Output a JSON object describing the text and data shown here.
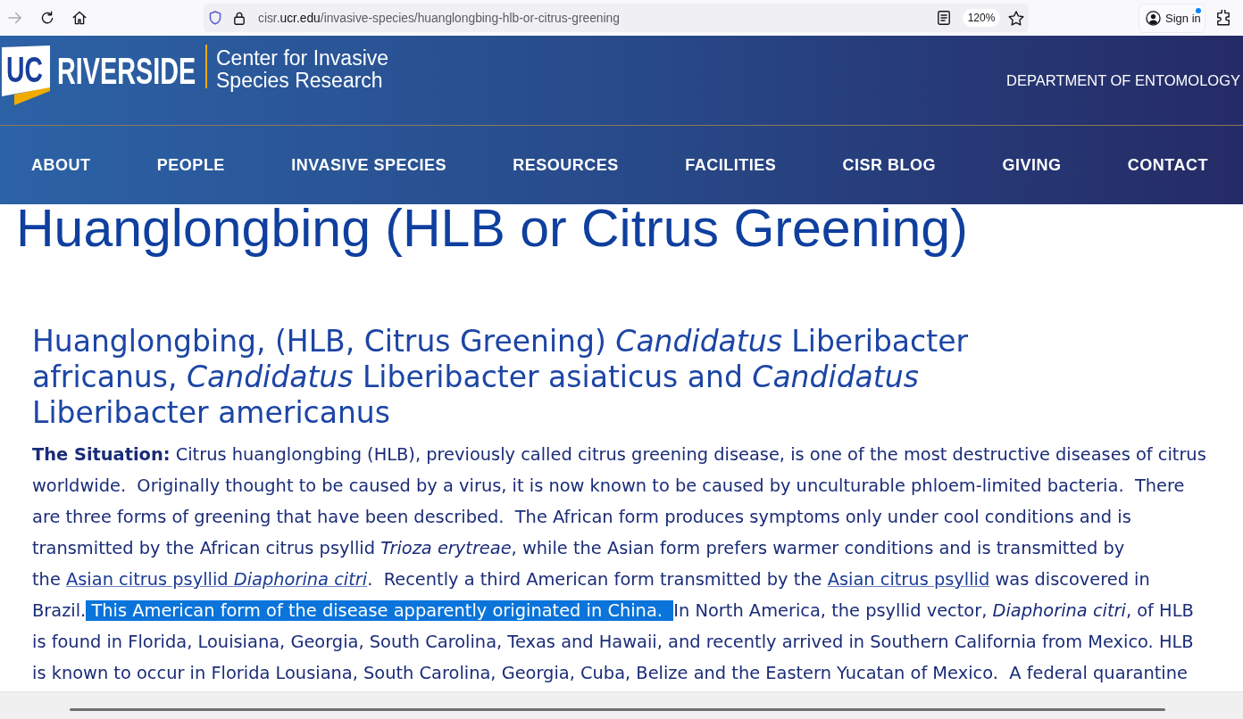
{
  "browser": {
    "nav_buttons": [
      {
        "kind": "forward",
        "disabled": true
      },
      {
        "kind": "reload",
        "disabled": false
      },
      {
        "kind": "home",
        "disabled": false
      }
    ],
    "address": {
      "prefix": "cisr.",
      "domain": "ucr.edu",
      "path": "/invasive-species/huanglongbing-hlb-or-citrus-greening",
      "zoom": "120%"
    },
    "account": {
      "label": "Sign in",
      "notification": true
    }
  },
  "header": {
    "logo_badge": "UC",
    "wordmark": "RIVERSIDE",
    "site_title": "Center for Invasive Species Research",
    "department": "DEPARTMENT OF ENTOMOLOGY"
  },
  "nav": {
    "items": [
      "ABOUT",
      "PEOPLE",
      "INVASIVE SPECIES",
      "RESOURCES",
      "FACILITIES",
      "CISR BLOG",
      "GIVING",
      "CONTACT"
    ]
  },
  "content": {
    "title": "Huanglongbing (HLB or Citrus Greening)",
    "heading": "Huanglongbing, (HLB, Citrus Greening) *Candidatus* Liberibacter africanus, *Candidatus* Liberibacter asiaticus and *Candidatus* Liberibacter americanus",
    "paragraph": [
      {
        "kind": "text",
        "selected": false,
        "text": "**The Situation:** Citrus huanglongbing (HLB), previously called citrus greening disease, is one of the most destructive diseases of citrus worldwide.  Originally thought to be caused by a virus, it is now known to be caused by unculturable phloem-limited bacteria.  There are three forms of greening that have been described.  The African form produces symptoms only under cool conditions and is transmitted by the African citrus psyllid *Trioza erytreae*, while the Asian form prefers warmer conditions and is transmitted by the "
      },
      {
        "kind": "link",
        "selected": false,
        "text": "Asian citrus psyllid *Diaphorina citri*"
      },
      {
        "kind": "text",
        "selected": false,
        "text": ".  Recently a third American form transmitted by the "
      },
      {
        "kind": "link",
        "selected": false,
        "text": "Asian citrus psyllid"
      },
      {
        "kind": "text",
        "selected": false,
        "text": " was discovered in Brazil."
      },
      {
        "kind": "text",
        "selected": true,
        "text": " This American form of the disease apparently originated in China.  "
      },
      {
        "kind": "text",
        "selected": false,
        "text": "In North America, the psyllid vector, *Diaphorina citri*, of HLB is found in Florida, Louisiana, Georgia, South Carolina, Texas and Hawaii, and recently arrived in Southern California from Mexico. HLB is known to occur in Florida Lousiana, South Carolina, Georgia, Cuba, Belize and the Eastern Yucatan of Mexico.  A federal quarantine"
      }
    ]
  }
}
